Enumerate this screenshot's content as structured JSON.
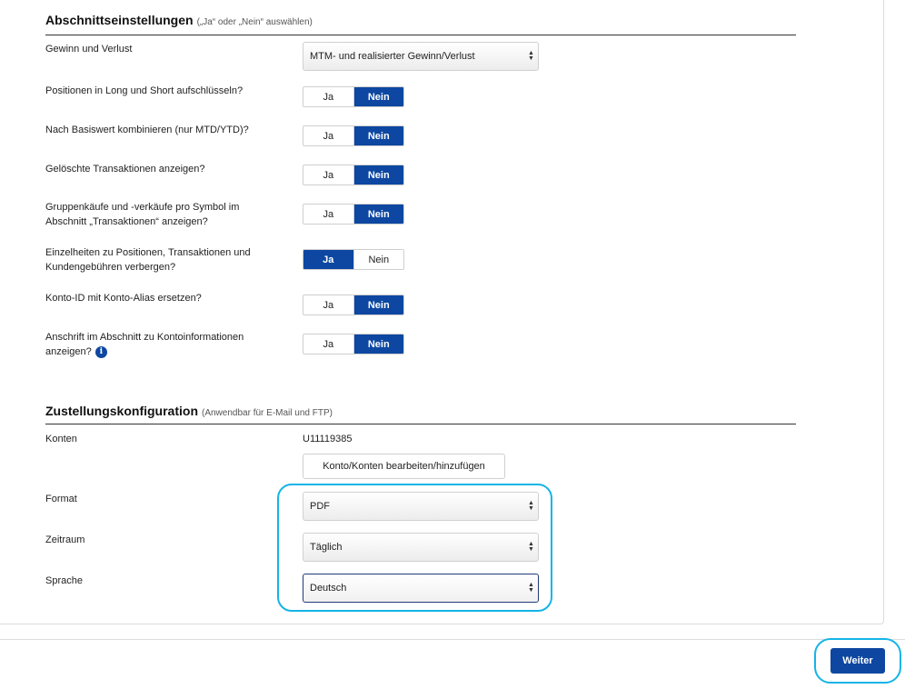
{
  "section_settings": {
    "title": "Abschnittseinstellungen",
    "note": "(„Ja“ oder „Nein“ auswählen)",
    "profit_loss": {
      "label": "Gewinn und Verlust",
      "value": "MTM- und realisierter Gewinn/Verlust"
    },
    "rows": [
      {
        "label": "Positionen in Long und Short aufschlüsseln?",
        "yes": "Ja",
        "no": "Nein",
        "selected": "Nein"
      },
      {
        "label": "Nach Basiswert kombinieren (nur MTD/YTD)?",
        "yes": "Ja",
        "no": "Nein",
        "selected": "Nein"
      },
      {
        "label": "Gelöschte Transaktionen anzeigen?",
        "yes": "Ja",
        "no": "Nein",
        "selected": "Nein"
      },
      {
        "label": "Gruppenkäufe und -verkäufe pro Symbol im Abschnitt „Transaktionen“ anzeigen?",
        "yes": "Ja",
        "no": "Nein",
        "selected": "Nein"
      },
      {
        "label": "Einzelheiten zu Positionen, Transaktionen und Kundengebühren verbergen?",
        "yes": "Ja",
        "no": "Nein",
        "selected": "Ja"
      },
      {
        "label": "Konto-ID mit Konto-Alias ersetzen?",
        "yes": "Ja",
        "no": "Nein",
        "selected": "Nein"
      },
      {
        "label": "Anschrift im Abschnitt zu Kontoinformationen anzeigen?",
        "yes": "Ja",
        "no": "Nein",
        "selected": "Nein",
        "info_icon": "info-icon"
      }
    ]
  },
  "delivery": {
    "title": "Zustellungskonfiguration",
    "note": "(Anwendbar für E-Mail und FTP)",
    "accounts_label": "Konten",
    "account_id": "U11119385",
    "edit_accounts_label": "Konto/Konten bearbeiten/hinzufügen",
    "format_label": "Format",
    "format_value": "PDF",
    "period_label": "Zeitraum",
    "period_value": "Täglich",
    "language_label": "Sprache",
    "language_value": "Deutsch"
  },
  "footer": {
    "next_label": "Weiter"
  },
  "colors": {
    "primary": "#0d47a1",
    "highlight": "#14b4e6"
  }
}
